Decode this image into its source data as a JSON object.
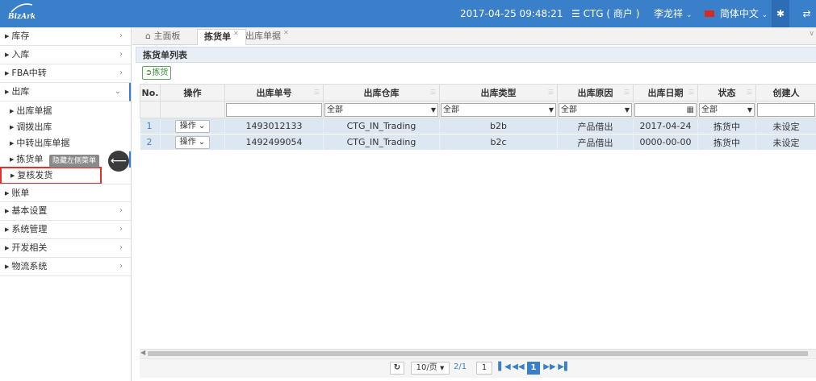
{
  "header": {
    "logo_text": "BizArk",
    "datetime": "2017-04-25 09:48:21",
    "company": "CTG ( 商户 )",
    "user": "李龙祥",
    "language": "简体中文",
    "pin_icon": "pin-icon",
    "swap_icon": "swap-icon"
  },
  "sidebar": {
    "items_top": [
      {
        "label": "库存"
      },
      {
        "label": "入库"
      },
      {
        "label": "FBA中转"
      },
      {
        "label": "出库"
      }
    ],
    "sub_items": [
      {
        "label": "出库单据"
      },
      {
        "label": "调拨出库"
      },
      {
        "label": "中转出库单据"
      },
      {
        "label": "拣货单"
      },
      {
        "label": "复核发货"
      }
    ],
    "items_bottom": [
      {
        "label": "账单"
      },
      {
        "label": "基本设置"
      },
      {
        "label": "系统管理"
      },
      {
        "label": "开发相关"
      },
      {
        "label": "物流系统"
      }
    ],
    "tooltip": "隐藏左侧菜单"
  },
  "tabs": [
    {
      "label": "主面板"
    },
    {
      "label": "拣货单"
    },
    {
      "label": "出库单据"
    }
  ],
  "panel": {
    "title": "拣货单列表",
    "pick_button": "拣货"
  },
  "grid": {
    "columns": [
      "No.",
      "操作",
      "出库单号",
      "出库仓库",
      "出库类型",
      "出库原因",
      "出库日期",
      "状态",
      "创建人"
    ],
    "filters": {
      "warehouse": "全部",
      "type": "全部",
      "reason": "全部",
      "status": "全部"
    },
    "rows": [
      {
        "no": "1",
        "action": "操作",
        "order_no": "1493012133",
        "warehouse": "CTG_IN_Trading",
        "type": "b2b",
        "reason": "产品借出",
        "date": "2017-04-24",
        "status": "拣货中",
        "creator": "未设定"
      },
      {
        "no": "2",
        "action": "操作",
        "order_no": "1492499054",
        "warehouse": "CTG_IN_Trading",
        "type": "b2c",
        "reason": "产品借出",
        "date": "0000-00-00",
        "status": "拣货中",
        "creator": "未设定"
      }
    ]
  },
  "pager": {
    "page_size": "10/页",
    "page_info": "2/1",
    "current_input": "1",
    "current_page": "1"
  }
}
